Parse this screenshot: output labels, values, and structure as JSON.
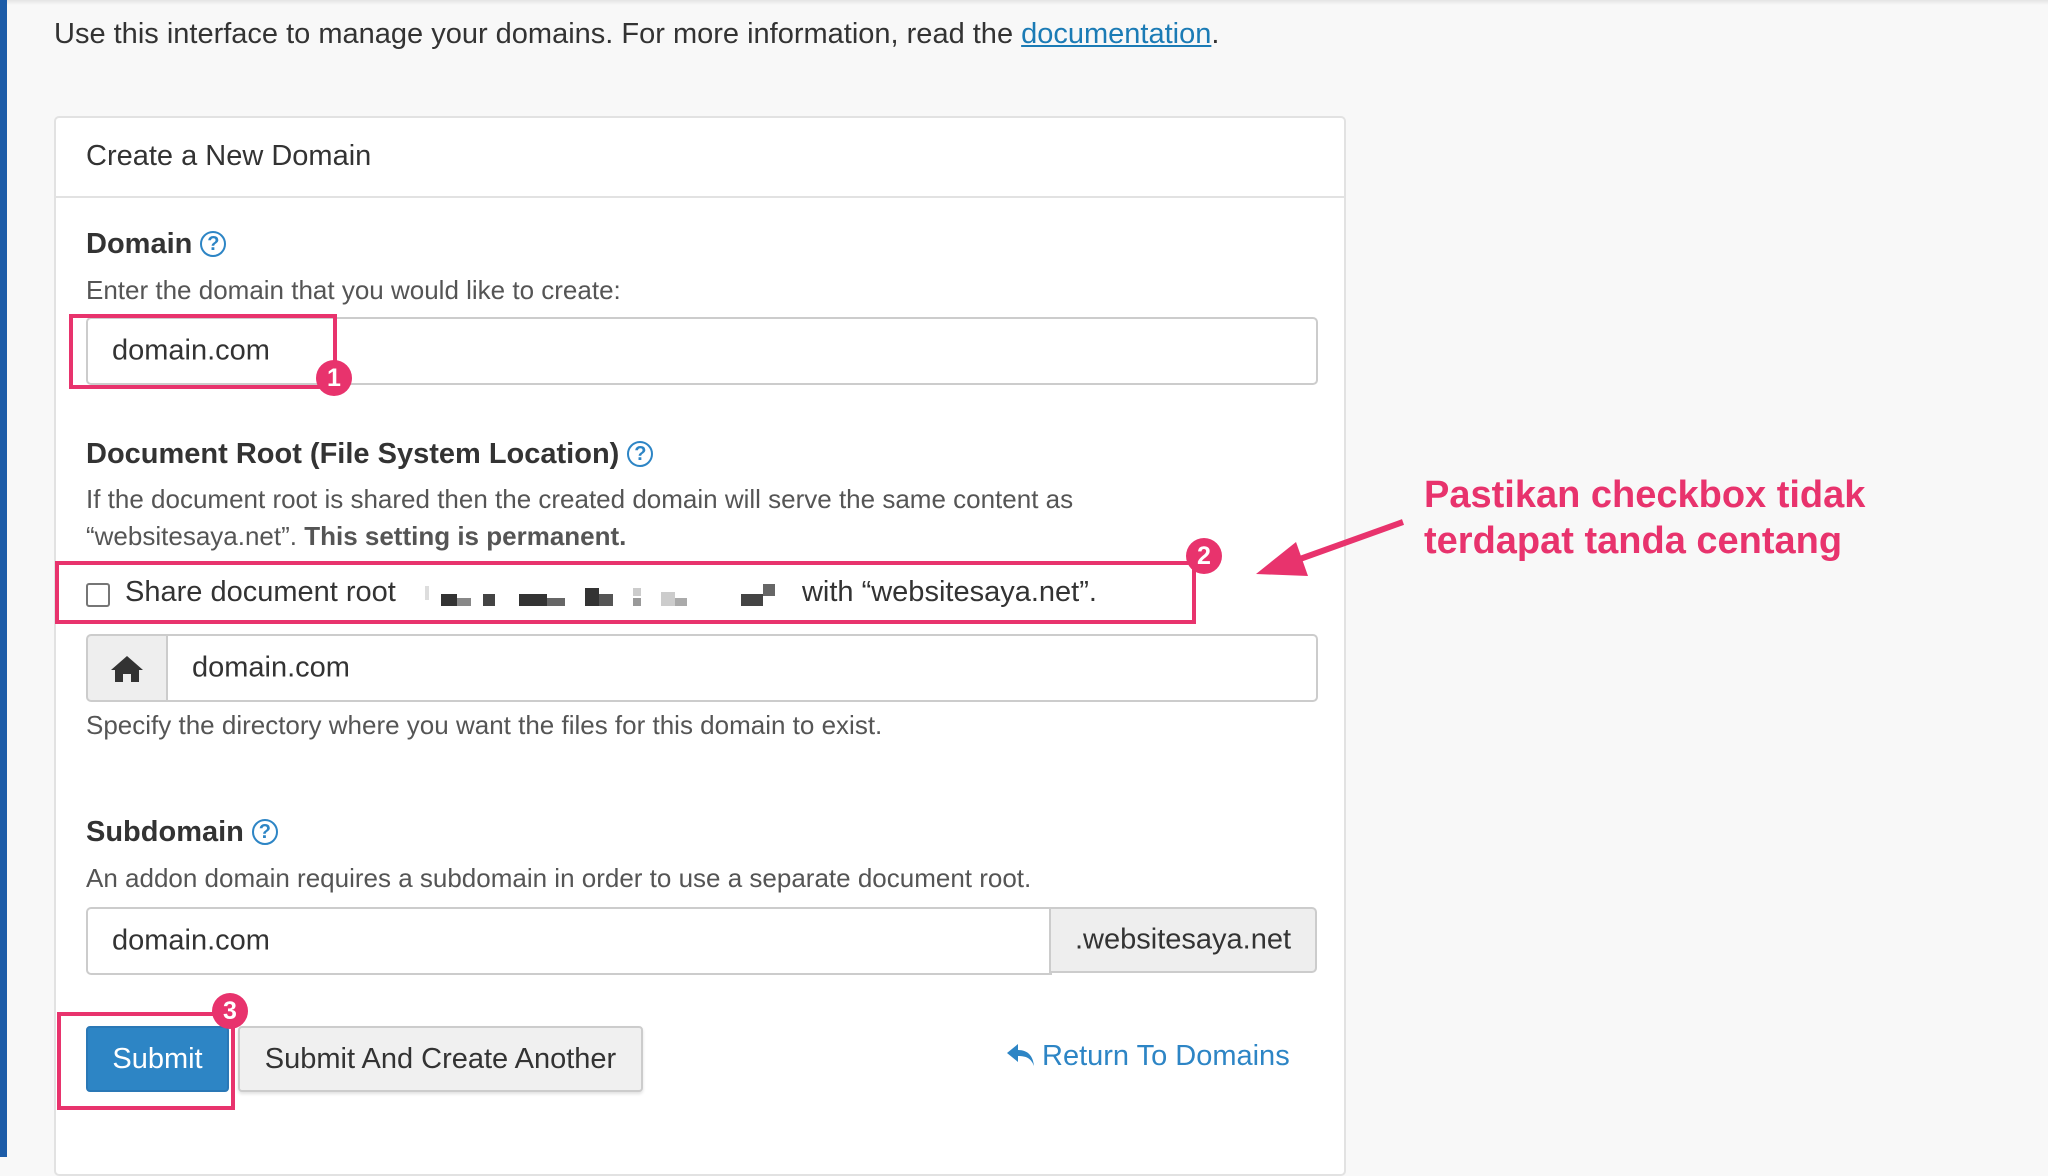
{
  "intro": {
    "text": "Use this interface to manage your domains. For more information, read the ",
    "link": "documentation",
    "end": "."
  },
  "panel": {
    "title": "Create a New Domain"
  },
  "domain": {
    "label": "Domain",
    "help_icon": "question-circle-icon",
    "description": "Enter the domain that you would like to create:",
    "value": "domain.com"
  },
  "docroot": {
    "label": "Document Root (File System Location)",
    "help_icon": "question-circle-icon",
    "description_line1": "If the document root is shared then the created domain will serve the same content as",
    "description_line2": "“websitesaya.net”.",
    "description_bold": "This setting is permanent.",
    "checkbox_checked": false,
    "checkbox_label_start": "Share document root",
    "checkbox_label_end": "with “websitesaya.net”.",
    "home_icon": "home-icon",
    "value": "domain.com",
    "hint": "Specify the directory where you want the files for this domain to exist."
  },
  "subdomain": {
    "label": "Subdomain",
    "help_icon": "question-circle-icon",
    "description": "An addon domain requires a subdomain in order to use a separate document root.",
    "value": "domain.com",
    "suffix": ".websitesaya.net"
  },
  "actions": {
    "submit": "Submit",
    "submit_another": "Submit And Create Another",
    "return": "Return To Domains",
    "return_icon": "reply-arrow-icon"
  },
  "annotations": {
    "badges": [
      "1",
      "2",
      "3"
    ],
    "note_line1": "Pastikan checkbox tidak",
    "note_line2": "terdapat tanda centang",
    "color": "#e8336d"
  },
  "colors": {
    "link": "#1b7bb5",
    "primary_button": "#2d85c5",
    "sidebar": "#1c5ca8"
  }
}
